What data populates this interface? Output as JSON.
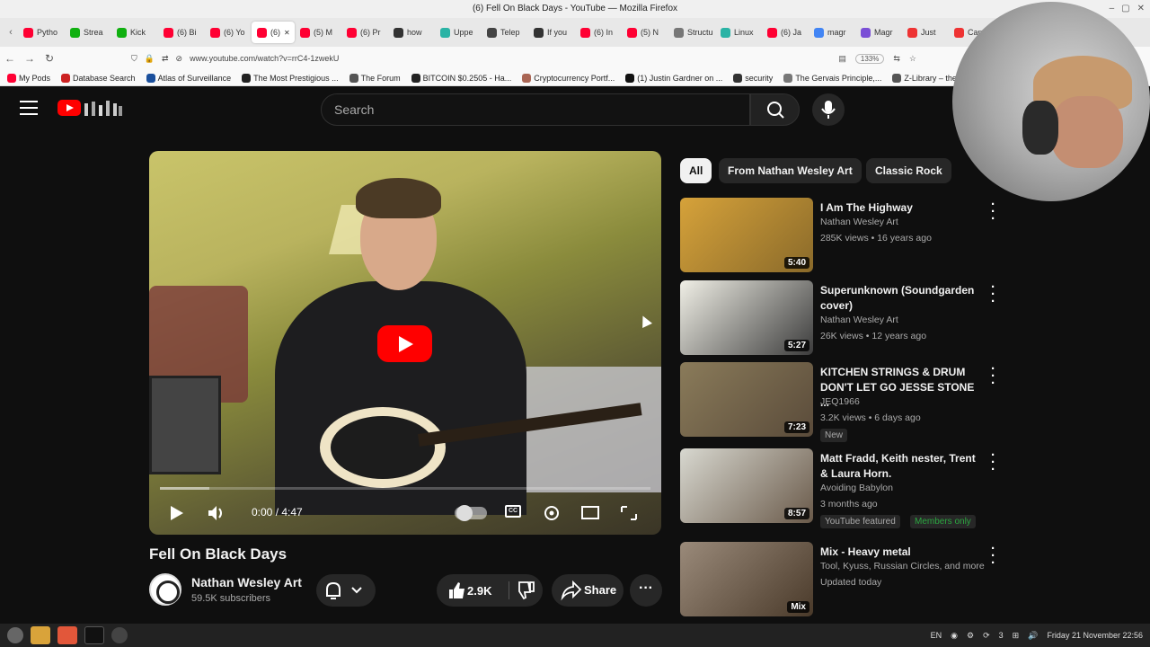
{
  "window": {
    "title": "(6) Fell On Black Days - YouTube — Mozilla Firefox",
    "controls": [
      "–",
      "▢",
      "✕"
    ]
  },
  "tabs": [
    {
      "label": "Pytho",
      "color": "#ff0033"
    },
    {
      "label": "Strea",
      "color": "#10b010"
    },
    {
      "label": "Kick",
      "color": "#10b010"
    },
    {
      "label": "(6) Bi",
      "color": "#ff0033"
    },
    {
      "label": "(6) Yo",
      "color": "#ff0033"
    },
    {
      "label": "(6)",
      "color": "#ff0033",
      "active": true
    },
    {
      "label": "(5) M",
      "color": "#ff0033"
    },
    {
      "label": "(6) Pr",
      "color": "#ff0033"
    },
    {
      "label": "how",
      "color": "#333333"
    },
    {
      "label": "Uppe",
      "color": "#2ab3a5"
    },
    {
      "label": "Telep",
      "color": "#444444"
    },
    {
      "label": "If you",
      "color": "#333333"
    },
    {
      "label": "(6) In",
      "color": "#ff0033"
    },
    {
      "label": "(5) N",
      "color": "#ff0033"
    },
    {
      "label": "Structu",
      "color": "#777777"
    },
    {
      "label": "Linux",
      "color": "#2ab3a5"
    },
    {
      "label": "(6) Ja",
      "color": "#ff0033"
    },
    {
      "label": "magr",
      "color": "#4285f4"
    },
    {
      "label": "Magr",
      "color": "#7a4fd6"
    },
    {
      "label": "Just",
      "color": "#e33"
    },
    {
      "label": "Can t",
      "color": "#e33"
    }
  ],
  "navbar": {
    "url": "www.youtube.com/watch?v=rrC4-1zwekU",
    "zoom": "133%"
  },
  "bookmarks": [
    {
      "label": "My Pods",
      "color": "#ff0033"
    },
    {
      "label": "Database Search",
      "color": "#c22"
    },
    {
      "label": "Atlas of Surveillance",
      "color": "#1a4f9c"
    },
    {
      "label": "The Most Prestigious ...",
      "color": "#222"
    },
    {
      "label": "The Forum",
      "color": "#555"
    },
    {
      "label": "BITCOIN $0.2505 - Ha...",
      "color": "#222"
    },
    {
      "label": "Cryptocurrency Portf...",
      "color": "#a65"
    },
    {
      "label": "(1) Justin Gardner on ...",
      "color": "#111"
    },
    {
      "label": "security",
      "color": "#333"
    },
    {
      "label": "The Gervais Principle,...",
      "color": "#777"
    },
    {
      "label": "Z-Library – the world'",
      "color": "#555"
    }
  ],
  "youtube": {
    "search_placeholder": "Search",
    "doodle_text": "ꟸ𝅘𝅥𝅮ꟸ"
  },
  "player": {
    "time_current": "0:00",
    "time_total": "4:47",
    "time_display": "0:00 / 4:47",
    "progress": 0.1,
    "cc_label": "CC"
  },
  "video": {
    "title": "Fell On Black Days",
    "channel": "Nathan Wesley Art",
    "subscribers": "59.5K subscribers",
    "likes": "2.9K",
    "share_label": "Share"
  },
  "chips": [
    "All",
    "From Nathan Wesley Art",
    "Classic Rock"
  ],
  "recommendations": [
    {
      "title": "I Am The Highway",
      "channel": "Nathan Wesley Art",
      "stats": "285K views • 16 years ago",
      "duration": "5:40",
      "thumb_colors": [
        "#d6a23a",
        "#8a6a2a"
      ]
    },
    {
      "title": "Superunknown (Soundgarden cover)",
      "channel": "Nathan Wesley Art",
      "stats": "26K views • 12 years ago",
      "duration": "5:27",
      "thumb_colors": [
        "#f0efe6",
        "#3c3c3c"
      ]
    },
    {
      "title": "KITCHEN STRINGS & DRUM DON'T LET GO JESSE STONE ...",
      "channel": "JEQ1966",
      "stats": "3.2K views • 6 days ago",
      "duration": "7:23",
      "badge": "New",
      "thumb_colors": [
        "#8a7b5a",
        "#5a4b3a"
      ]
    },
    {
      "title": "Matt Fradd, Keith nester, Trent & Laura Horn.",
      "channel": "Avoiding Babylon",
      "stats": "3 months ago",
      "duration": "8:57",
      "badge": "YouTube featured",
      "badge2": "Members only",
      "thumb_colors": [
        "#d8d8d0",
        "#6a5a4a"
      ]
    },
    {
      "title": "Mix - Heavy metal",
      "channel": "Tool, Kyuss, Russian Circles, and more",
      "stats": "Updated today",
      "duration": "Mix",
      "thumb_colors": [
        "#9a8a7a",
        "#4a3a2a"
      ]
    }
  ],
  "taskbar": {
    "lang": "EN",
    "tray_count": "3",
    "clock": "Friday 21 November 22:56"
  }
}
